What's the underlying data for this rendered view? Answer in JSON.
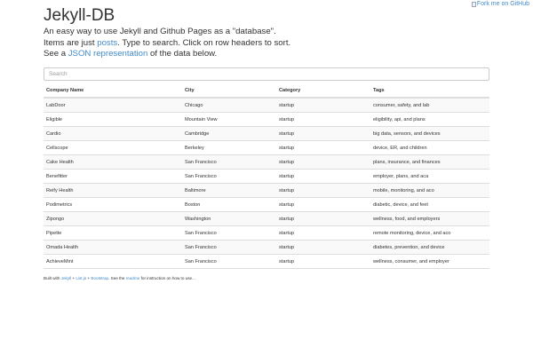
{
  "fork_ribbon": {
    "alt": "Fork me on GitHub"
  },
  "page": {
    "title": "Jekyll-DB"
  },
  "intro": {
    "line1": "An easy way to use Jekyll and Github Pages as a \"database\".",
    "line2_prefix": "Items are just ",
    "line2_link": "posts",
    "line2_suffix": ". Type to search. Click on row headers to sort.",
    "line3_prefix": "See a ",
    "line3_link": "JSON representation",
    "line3_suffix": " of the data below."
  },
  "search": {
    "placeholder": "Search",
    "value": ""
  },
  "table": {
    "headers": [
      "Company Name",
      "City",
      "Category",
      "Tags"
    ],
    "rows": [
      [
        "LabDoor",
        "Chicago",
        "startup",
        "consumer, safety, and lab"
      ],
      [
        "Eligible",
        "Mountain View",
        "startup",
        "eligibility, api, and plans"
      ],
      [
        "Cardio",
        "Cambridge",
        "startup",
        "big data, sensors, and devices"
      ],
      [
        "Cellscope",
        "Berkeley",
        "startup",
        "device, ER, and children"
      ],
      [
        "Cake Health",
        "San Francisco",
        "startup",
        "plans, insurance, and finances"
      ],
      [
        "Benefitter",
        "San Francisco",
        "startup",
        "employer, plans, and aca"
      ],
      [
        "Reify Health",
        "Baltimore",
        "startup",
        "mobile, monitoring, and aco"
      ],
      [
        "Podimetrics",
        "Boston",
        "startup",
        "diabetic, device, and feet"
      ],
      [
        "Zipongo",
        "Washington",
        "startup",
        "wellness, food, and employers"
      ],
      [
        "Pipette",
        "San Francisco",
        "startup",
        "remote monitoring, device, and aco"
      ],
      [
        "Omada Health",
        "San Francisco",
        "startup",
        "diabetes, prevention, and device"
      ],
      [
        "AchieveMint",
        "San Francisco",
        "startup",
        "wellness, consumer, and employer"
      ]
    ]
  },
  "footer": {
    "built_with": "Built with ",
    "link_jekyll": "Jekyll",
    "sep1": " + ",
    "link_listjs": "List.js",
    "sep2": " + ",
    "link_bootstrap": "Bootstrap",
    "see_the": ". See the ",
    "link_readme": "readme",
    "suffix": " for instruction on how to use..."
  }
}
